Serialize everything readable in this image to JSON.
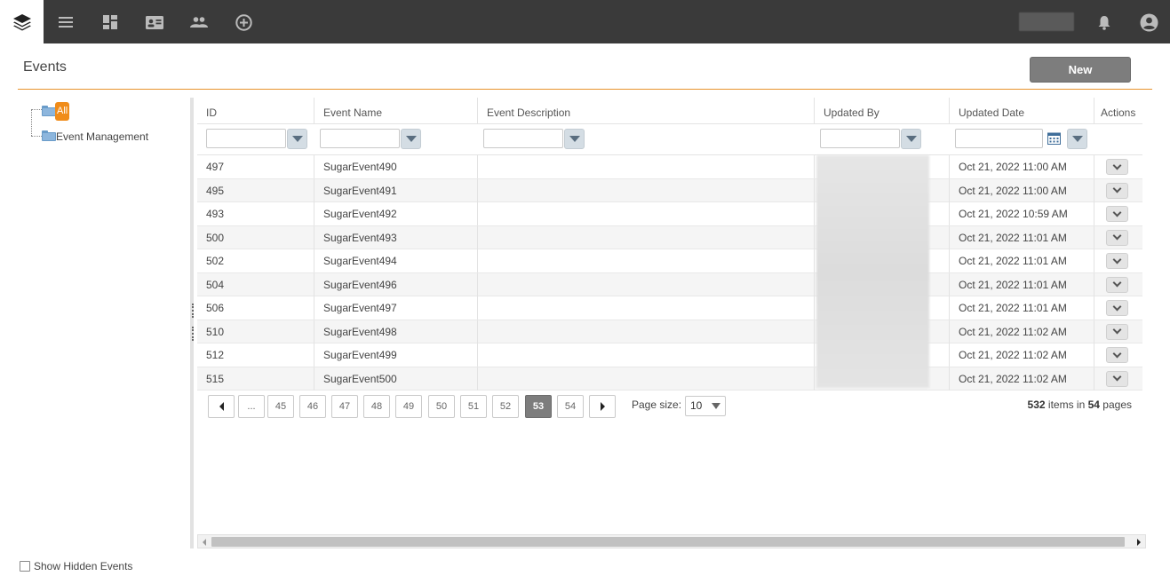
{
  "topbar": {
    "icons": [
      "layers-logo-icon",
      "menu-icon",
      "dashboard-icon",
      "id-card-icon",
      "people-icon",
      "add-circle-icon"
    ],
    "right_icons": [
      "bell-icon",
      "account-icon"
    ]
  },
  "header": {
    "title": "Events",
    "new_label": "New"
  },
  "tree": {
    "all_label": "All",
    "event_management_label": "Event Management"
  },
  "grid": {
    "columns": [
      "ID",
      "Event Name",
      "Event Description",
      "Updated By",
      "Updated Date",
      "Actions"
    ],
    "rows": [
      {
        "id": "497",
        "name": "SugarEvent490",
        "description": "",
        "date": "Oct 21, 2022 11:00 AM"
      },
      {
        "id": "495",
        "name": "SugarEvent491",
        "description": "",
        "date": "Oct 21, 2022 11:00 AM"
      },
      {
        "id": "493",
        "name": "SugarEvent492",
        "description": "",
        "date": "Oct 21, 2022 10:59 AM"
      },
      {
        "id": "500",
        "name": "SugarEvent493",
        "description": "",
        "date": "Oct 21, 2022 11:01 AM"
      },
      {
        "id": "502",
        "name": "SugarEvent494",
        "description": "",
        "date": "Oct 21, 2022 11:01 AM"
      },
      {
        "id": "504",
        "name": "SugarEvent496",
        "description": "",
        "date": "Oct 21, 2022 11:01 AM"
      },
      {
        "id": "506",
        "name": "SugarEvent497",
        "description": "",
        "date": "Oct 21, 2022 11:01 AM"
      },
      {
        "id": "510",
        "name": "SugarEvent498",
        "description": "",
        "date": "Oct 21, 2022 11:02 AM"
      },
      {
        "id": "512",
        "name": "SugarEvent499",
        "description": "",
        "date": "Oct 21, 2022 11:02 AM"
      },
      {
        "id": "515",
        "name": "SugarEvent500",
        "description": "",
        "date": "Oct 21, 2022 11:02 AM"
      }
    ]
  },
  "pager": {
    "ellipsis": "...",
    "pages": [
      "45",
      "46",
      "47",
      "48",
      "49",
      "50",
      "51",
      "52",
      "53",
      "54"
    ],
    "active_page": "53",
    "page_size_label": "Page size:",
    "page_size": "10",
    "total_items": "532",
    "items_in": "items in",
    "total_pages": "54",
    "pages_word": "pages"
  },
  "footer": {
    "show_hidden_label": "Show Hidden Events"
  },
  "colors": {
    "accent": "#f08c1a",
    "topbar": "#3a3a3a",
    "button": "#7d7d7d"
  }
}
